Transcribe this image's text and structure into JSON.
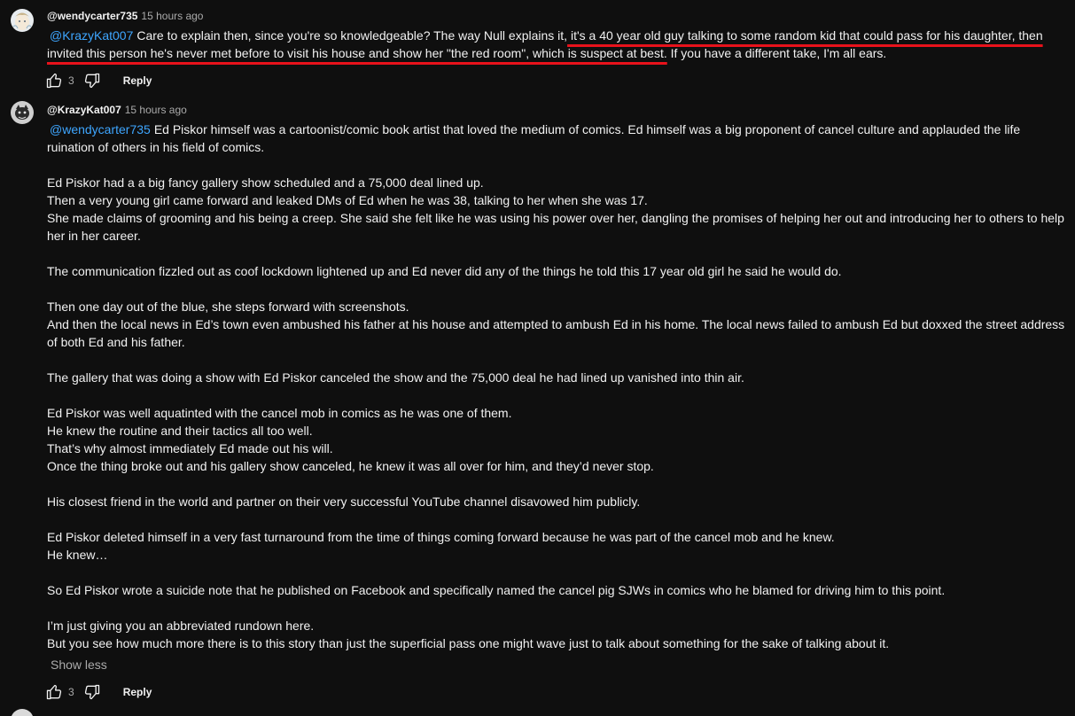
{
  "comments": [
    {
      "author": "@wendycarter735",
      "time": "15 hours ago",
      "mention": "@KrazyKat007",
      "text_start": "Care to explain then, since you're so knowledgeable? The way Null explains it,",
      "text_underlined": " it's a 40 year old guy talking to some random kid that could pass for his daughter, then invited this person he's never met before to visit his house and show her \"the red room\", which is suspect at best.",
      "text_end": " If you have a different take, I'm all ears.",
      "likes": "3",
      "reply_label": "Reply"
    },
    {
      "author": "@KrazyKat007",
      "time": "15 hours ago",
      "mention": "@wendycarter735",
      "first_text": "Ed Piskor himself was a cartoonist/comic book artist that loved the medium of comics. Ed himself was a big proponent of cancel culture and applauded the life ruination of others in his field of comics.",
      "lines": [
        "",
        "Ed Piskor had a a big fancy gallery show scheduled and a 75,000 deal lined up.",
        "Then a very young girl came forward and leaked DMs of Ed when he was 38, talking to her when she was 17.",
        "She made claims of grooming and his being a creep. She said she felt like he was using his power over her, dangling the promises of helping her out and introducing her to others to help her in her career.",
        "",
        "The communication fizzled out as coof lockdown lightened up and Ed never did any of the things he told this 17 year old girl he said he would do.",
        "",
        "Then one day out of the blue, she steps forward with screenshots.",
        "And then the local news in Ed’s town even ambushed his father at his house and attempted to ambush Ed in his home. The local news failed to ambush Ed but doxxed the street address of both Ed and his father.",
        "",
        "The gallery that was doing a show with Ed Piskor canceled the show and the 75,000 deal he had lined up vanished into thin air.",
        "",
        "Ed Piskor was well aquatinted with the cancel mob in comics as he was one of them.",
        "He knew the routine and their tactics all too well.",
        "That’s why almost immediately Ed made out his will.",
        "Once the thing broke out and his gallery show canceled, he knew it was all over for him, and they’d never stop.",
        "",
        "His closest friend in the world and partner on their very successful YouTube channel disavowed him publicly.",
        "",
        "Ed Piskor deleted himself in a very fast turnaround from the time of things coming forward because he was part of the cancel mob and he knew.",
        "He knew…",
        "",
        "So Ed Piskor wrote a suicide note that he published on Facebook and specifically named the cancel pig SJWs in comics who he blamed for driving him to this point.",
        "",
        "I’m just giving you an abbreviated rundown here.",
        "But you see how much more there is to this story than just the superficial pass one might wave just to talk about something for the sake of talking about it."
      ],
      "show_less_label": "Show less",
      "likes": "3",
      "reply_label": "Reply"
    }
  ],
  "colors": {
    "background": "#0f0f0f",
    "text": "#f1f1f1",
    "secondary_text": "#aaaaaa",
    "mention": "#3ea6ff",
    "underline": "#e8121b"
  },
  "icons": {
    "like": "thumbs-up-icon",
    "dislike": "thumbs-down-icon"
  }
}
